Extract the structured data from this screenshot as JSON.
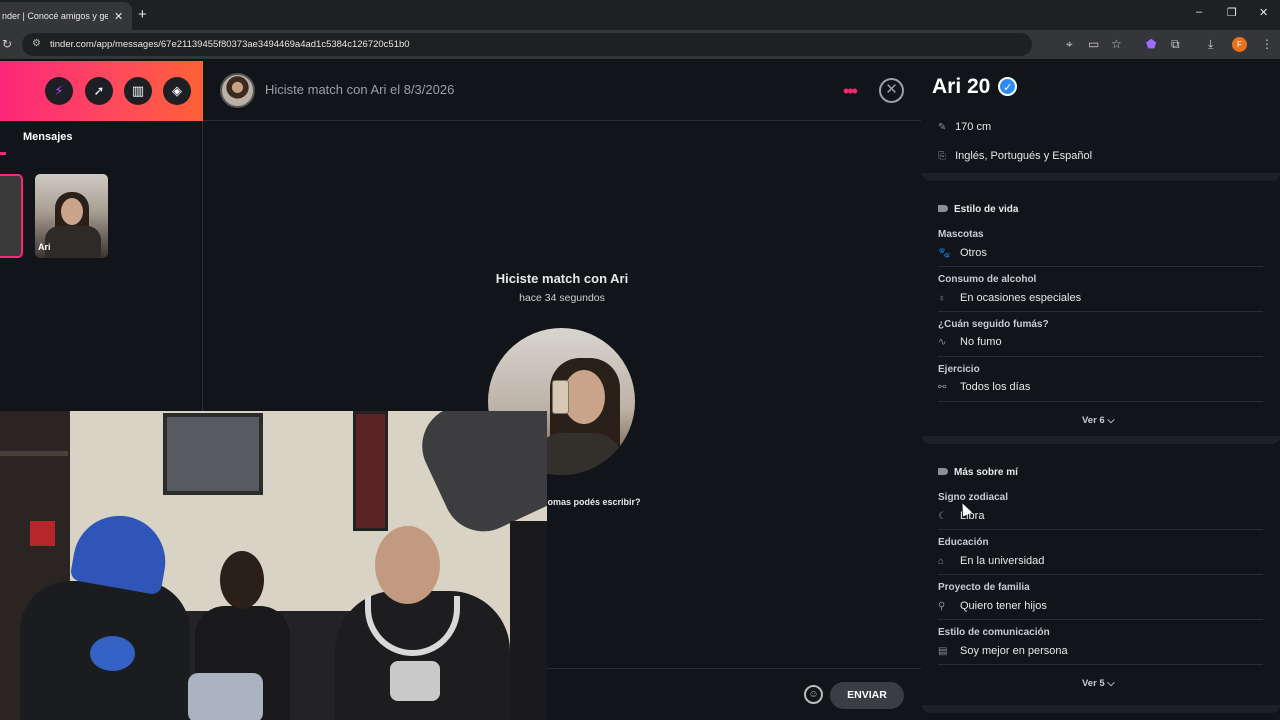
{
  "browser": {
    "tab_title": "nder | Conocé amigos y gente",
    "tab_close": "✕",
    "new_tab": "+",
    "url": "tinder.com/app/messages/67e21139455f80373ae3494469a4ad1c5384c126720c51b0",
    "window_controls": {
      "minimize": "–",
      "maximize": "❐",
      "close": "✕"
    },
    "profile_initial": "F"
  },
  "sidebar": {
    "tabs": {
      "messages_label": "Mensajes"
    },
    "matches": [
      {
        "name": "Ari"
      }
    ],
    "accent_color": "#fd267a"
  },
  "chat": {
    "header_title": "Hiciste match con Ari el 8/3/2026",
    "match_title": "Hiciste match con Ari",
    "match_time": "hace 34 segundos",
    "language_hint": "iomas podés escribir?",
    "send_label": "ENVIAR",
    "close_icon": "✕",
    "more_icon": "•••"
  },
  "profile": {
    "name_age": "Ari 20",
    "height": "170 cm",
    "languages": "Inglés, Portugués y Español",
    "lifestyle": {
      "title": "Estilo de vida",
      "items": [
        {
          "label": "Mascotas",
          "value": "Otros"
        },
        {
          "label": "Consumo de alcohol",
          "value": "En ocasiones especiales"
        },
        {
          "label": "¿Cuán seguido fumás?",
          "value": "No fumo"
        },
        {
          "label": "Ejercicio",
          "value": "Todos los días"
        }
      ],
      "more": "Ver 6 ⌵"
    },
    "about": {
      "title": "Más sobre mí",
      "items": [
        {
          "label": "Signo zodiacal",
          "value": "Libra"
        },
        {
          "label": "Educación",
          "value": "En la universidad"
        },
        {
          "label": "Proyecto de familia",
          "value": "Quiero tener hijos"
        },
        {
          "label": "Estilo de comunicación",
          "value": "Soy mejor en persona"
        }
      ],
      "more": "Ver 5 ⌵"
    },
    "verified_color": "#2f8bf0"
  }
}
